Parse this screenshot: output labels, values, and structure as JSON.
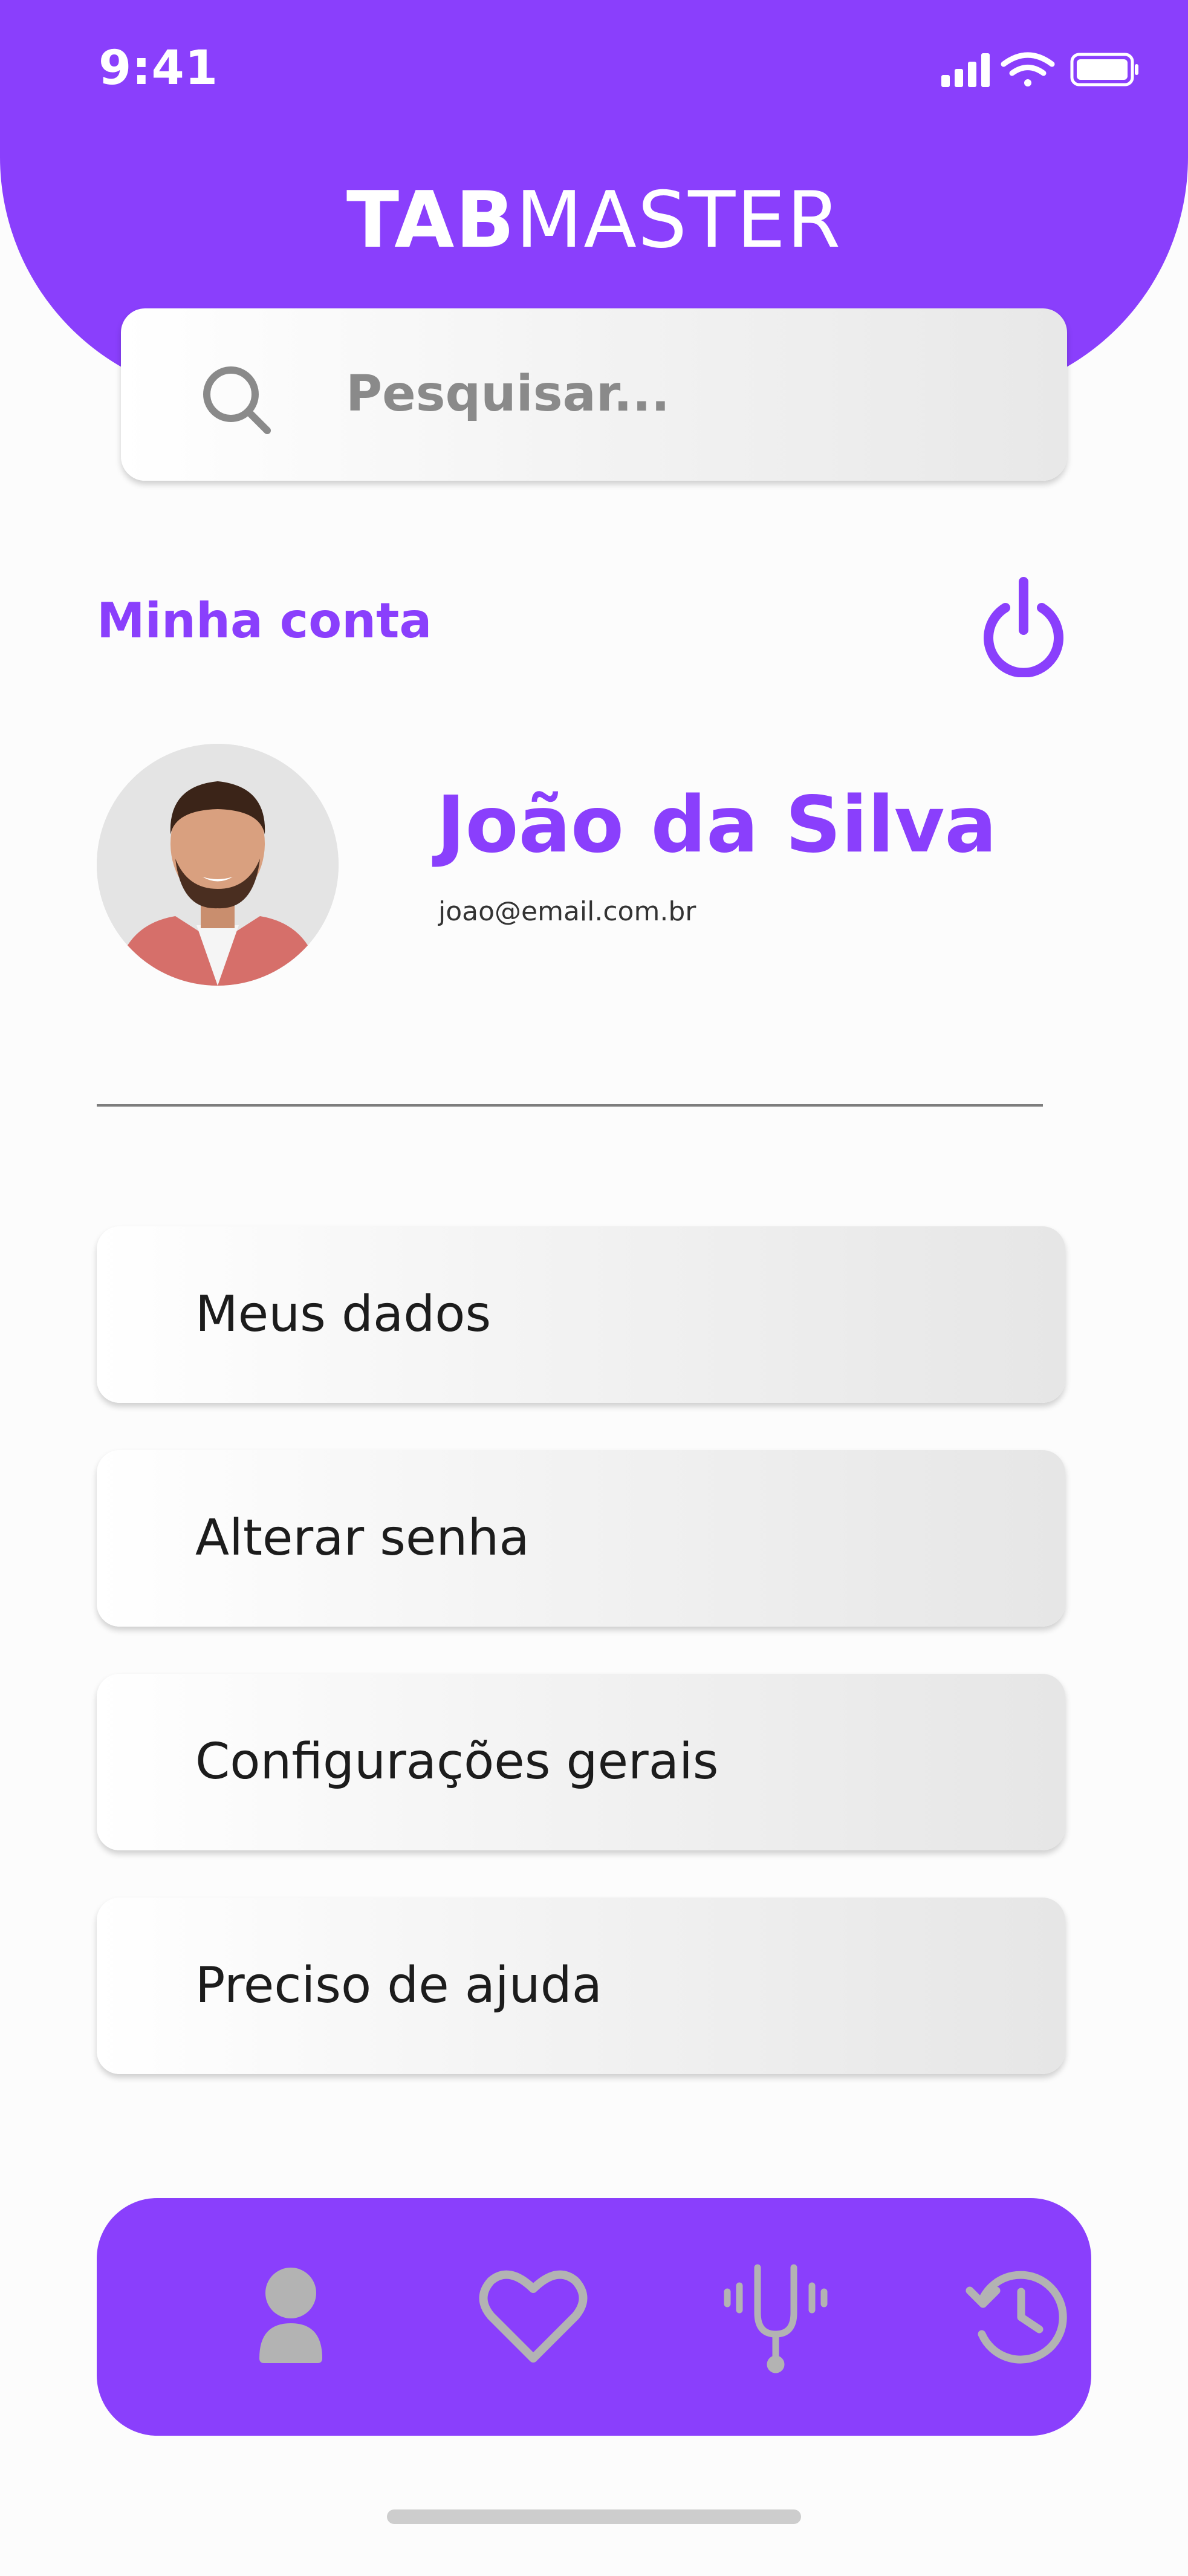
{
  "status_bar": {
    "time": "9:41",
    "icons": [
      "cellular-signal-icon",
      "wifi-icon",
      "battery-icon"
    ]
  },
  "header": {
    "brand_bold": "TAB",
    "brand_light": "MASTER",
    "color": "#8a3ffc"
  },
  "search": {
    "placeholder": "Pesquisar...",
    "value": "",
    "icon": "search-icon"
  },
  "account": {
    "section_title": "Minha conta",
    "logout_icon": "power-icon"
  },
  "user": {
    "name": "João da Silva",
    "email": "joao@email.com.br"
  },
  "menu": {
    "items": [
      {
        "label": "Meus dados"
      },
      {
        "label": "Alterar senha"
      },
      {
        "label": "Configurações gerais"
      },
      {
        "label": "Preciso de ajuda"
      }
    ]
  },
  "bottom_nav": {
    "items": [
      {
        "icon": "user-icon",
        "active": true
      },
      {
        "icon": "heart-icon",
        "active": false
      },
      {
        "icon": "tuning-fork-icon",
        "active": false
      },
      {
        "icon": "history-icon",
        "active": false
      }
    ]
  },
  "colors": {
    "accent": "#8a3ffc",
    "icon_inactive": "#b3b3b3",
    "text": "#1c1c1c"
  }
}
